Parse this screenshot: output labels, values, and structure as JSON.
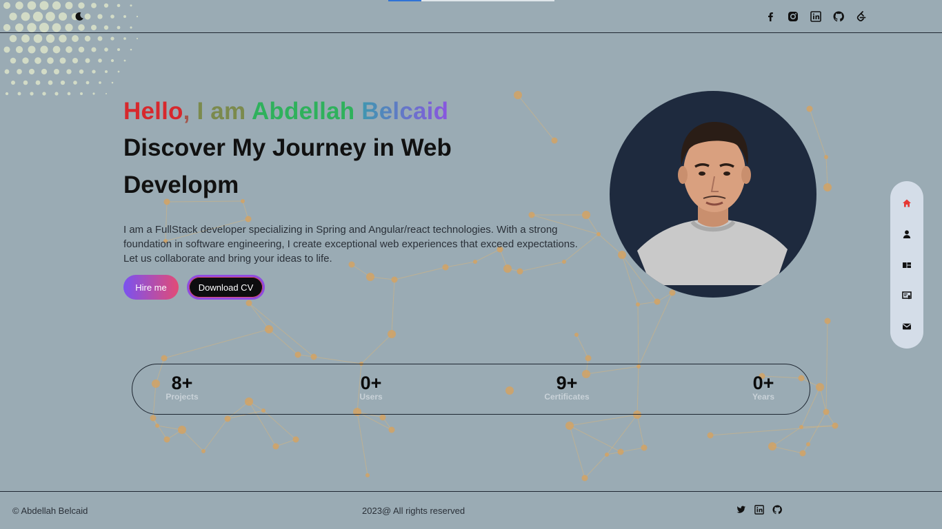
{
  "header": {
    "progress_percent": 20,
    "theme_toggle_icon": "moon-icon",
    "social_icons": [
      "facebook-icon",
      "instagram-icon",
      "linkedin-icon",
      "github-icon",
      "leetcode-icon"
    ]
  },
  "hero": {
    "greeting_words": [
      "Hello",
      ",",
      "I am",
      "Abdellah",
      "Belcaid"
    ],
    "headline": "Discover My Journey in Web Developm",
    "description": "I am a FullStack developer specializing in Spring and Angular/react technologies. With a strong foundation in software engineering, I create exceptional web experiences that exceed expectations. Let us collaborate and bring your ideas to life.",
    "hire_label": "Hire me",
    "cv_label": "Download CV"
  },
  "sidenav": {
    "items": [
      "home-icon",
      "user-icon",
      "projects-icon",
      "certificates-icon",
      "mail-icon"
    ],
    "active": "home-icon"
  },
  "stats": [
    {
      "value": "8+",
      "label": "Projects"
    },
    {
      "value": "0+",
      "label": "Users"
    },
    {
      "value": "9+",
      "label": "Certificates"
    },
    {
      "value": "0+",
      "label": "Years"
    }
  ],
  "footer": {
    "copyright": "© Abdellah Belcaid",
    "rights": "2023@ All rights reserved",
    "social_icons": [
      "twitter-icon",
      "linkedin-icon",
      "github-icon"
    ]
  },
  "colors": {
    "background": "#9aabb4",
    "accent_red": "#d7282d",
    "accent_green": "#2fb15c",
    "accent_purple": "#8a55e0",
    "avatar_bg": "#1e2a3e",
    "network": "#d9a25a"
  }
}
